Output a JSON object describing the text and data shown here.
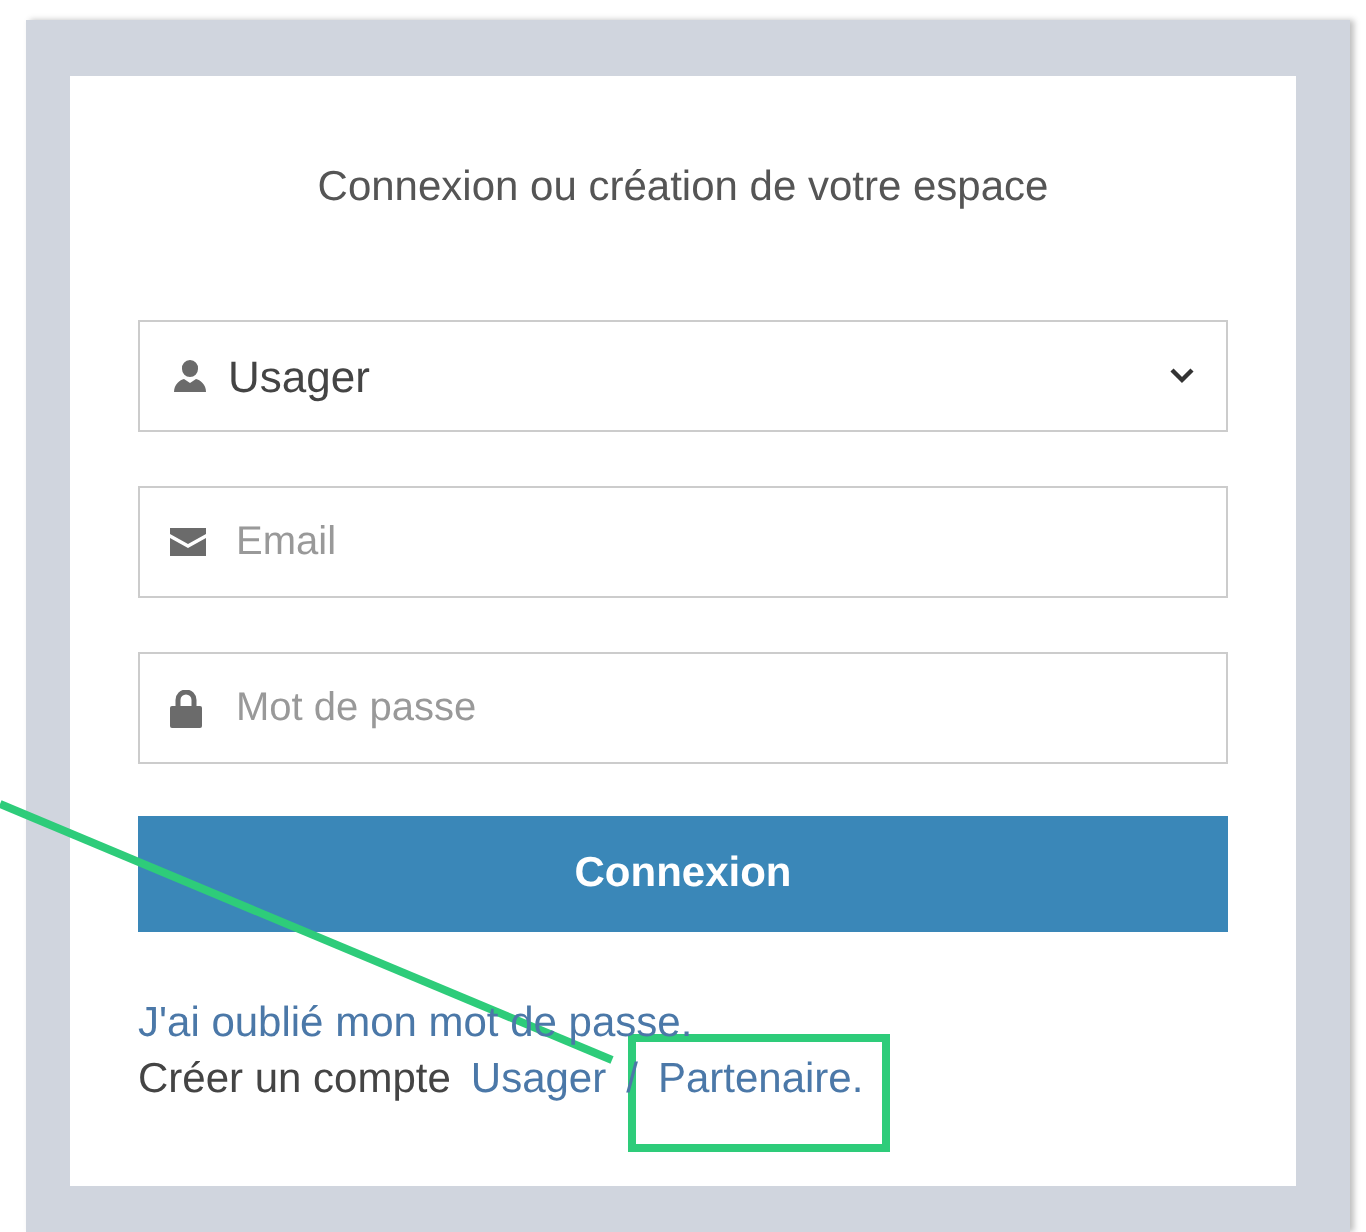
{
  "title": "Connexion ou création de votre espace",
  "fields": [
    {
      "kind": "select",
      "value": "Usager"
    },
    {
      "kind": "input",
      "placeholder": "Email"
    },
    {
      "kind": "input",
      "placeholder": "Mot de passe"
    }
  ],
  "button": "Connexion",
  "forgot_link": "J'ai oublié mon mot de passe.",
  "create_account": {
    "text": "Créer un compte",
    "links": [
      "Usager",
      "Partenaire."
    ],
    "separator": "/"
  }
}
